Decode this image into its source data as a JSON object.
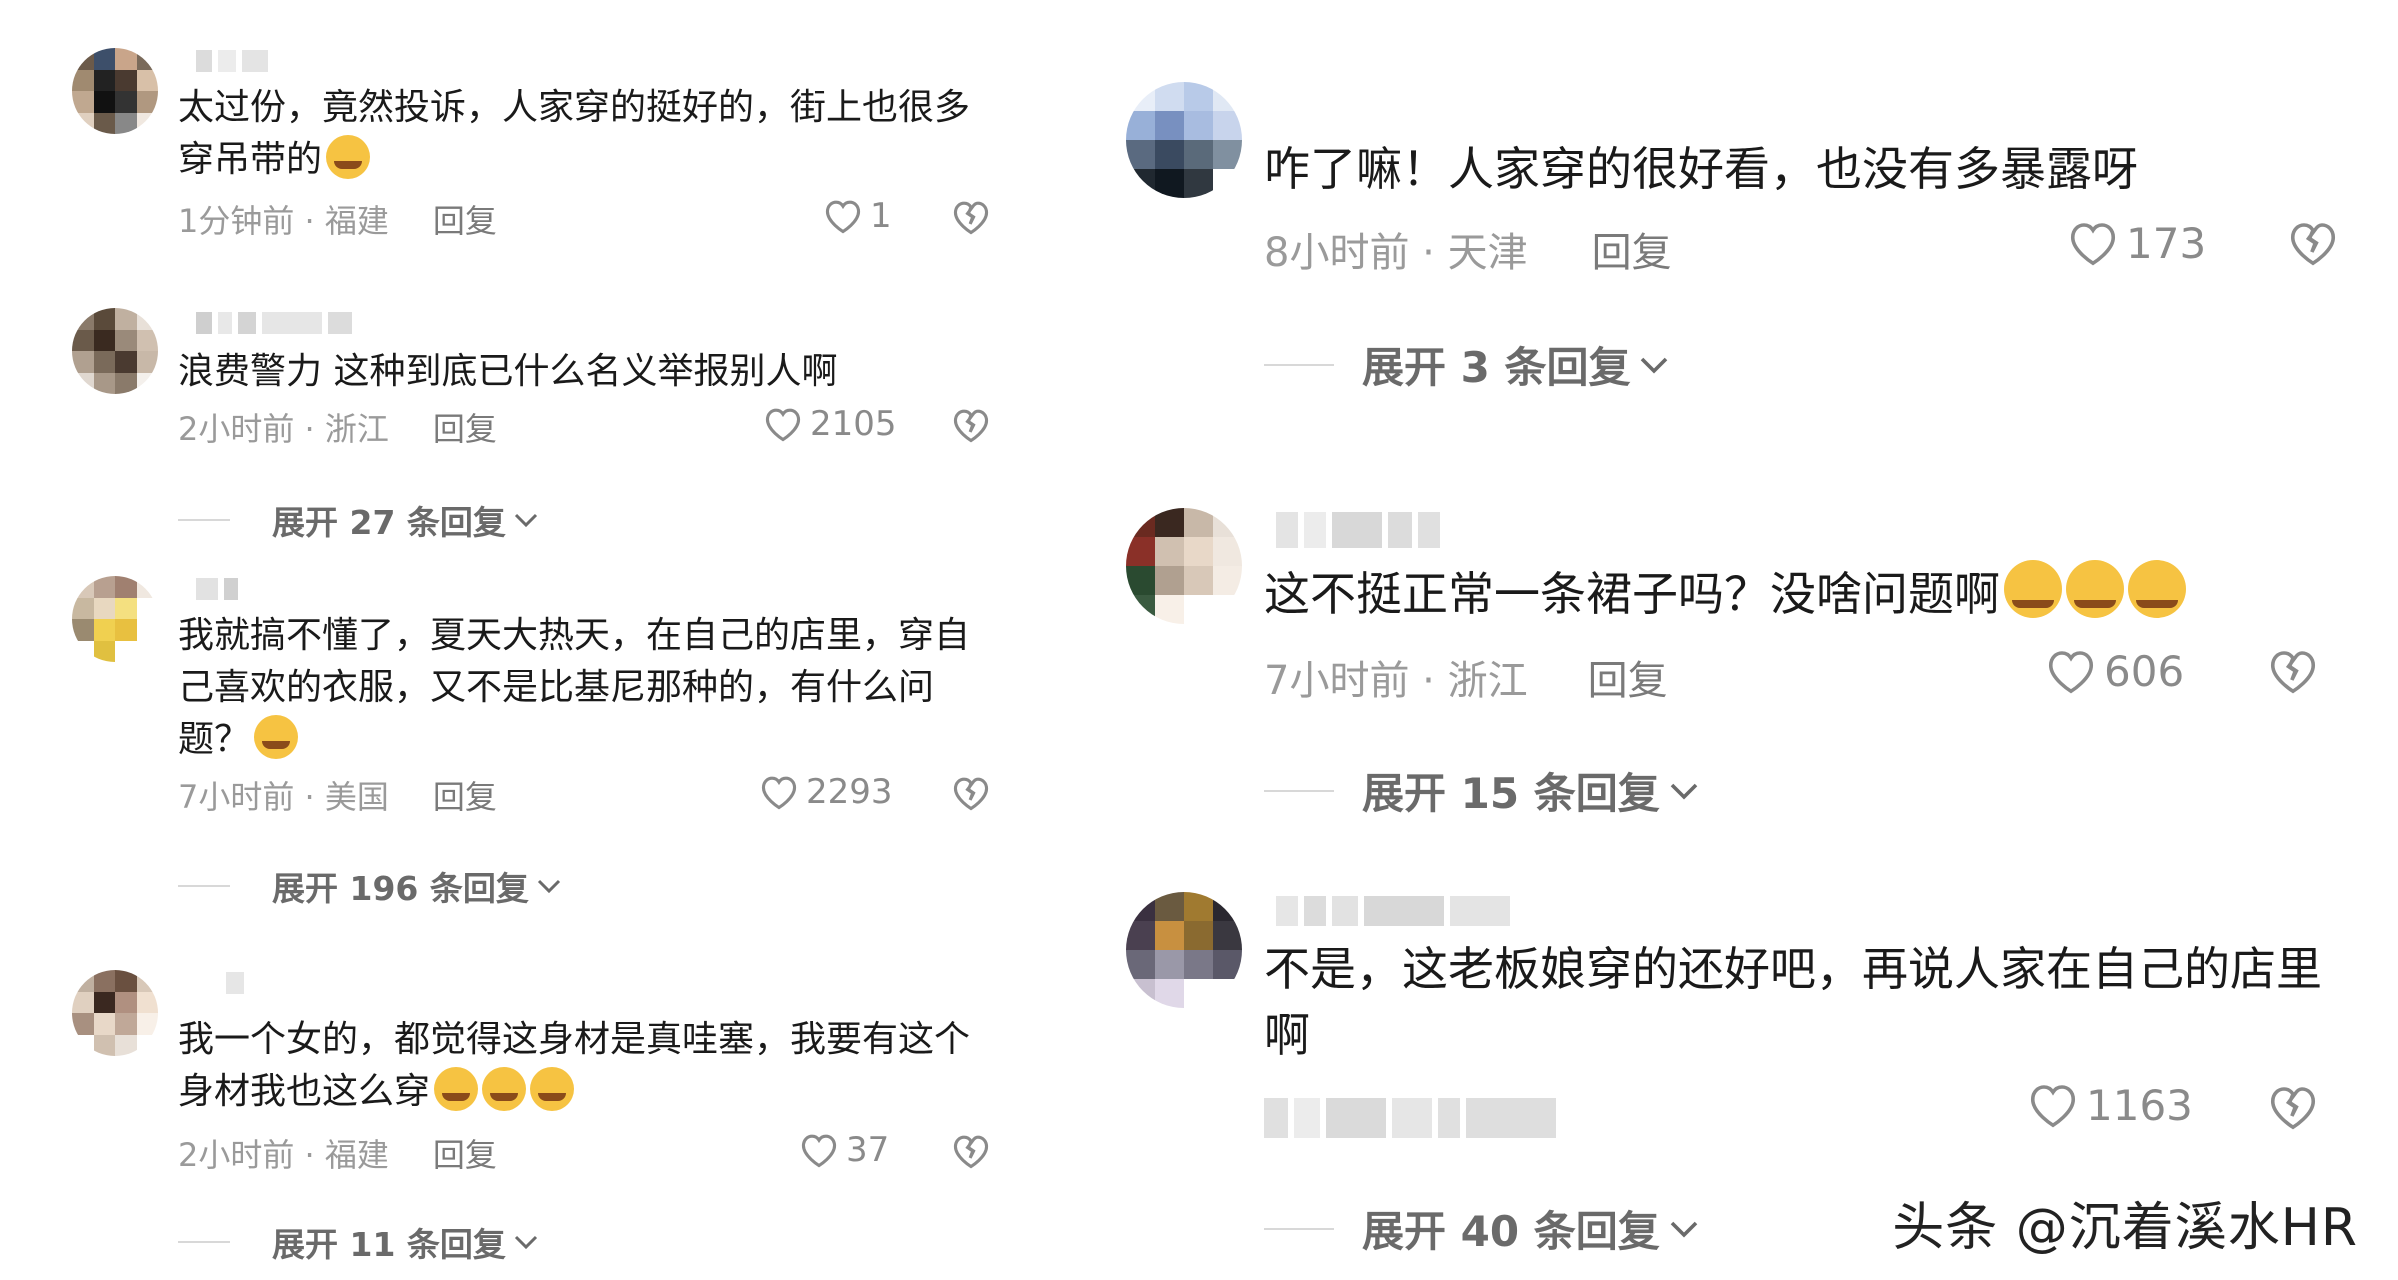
{
  "left_comments": [
    {
      "text": "太过份，竟然投诉，人家穿的挺好的，街上也很多穿吊带的",
      "emojis": 1,
      "time": "1分钟前 · 福建",
      "reply": "回复",
      "likes": "1",
      "expand": ""
    },
    {
      "text": "浪费警力  这种到底已什么名义举报别人啊",
      "emojis": 0,
      "time": "2小时前 · 浙江",
      "reply": "回复",
      "likes": "2105",
      "expand": "展开 27 条回复"
    },
    {
      "text": "我就搞不懂了，夏天大热天，在自己的店里，穿自己喜欢的衣服，又不是比基尼那种的，有什么问题？",
      "emojis": 1,
      "time": "7小时前 · 美国",
      "reply": "回复",
      "likes": "2293",
      "expand": "展开 196 条回复"
    },
    {
      "text": "我一个女的，都觉得这身材是真哇塞，我要有这个身材我也这么穿",
      "emojis": 3,
      "time": "2小时前 · 福建",
      "reply": "回复",
      "likes": "37",
      "expand": "展开 11 条回复"
    }
  ],
  "right_comments": [
    {
      "text": "咋了嘛！人家穿的很好看，也没有多暴露呀",
      "emojis": 0,
      "time": "8小时前 · 天津",
      "reply": "回复",
      "likes": "173",
      "expand": "展开 3 条回复"
    },
    {
      "text": "这不挺正常一条裙子吗？没啥问题啊",
      "emojis": 3,
      "time": "7小时前 · 浙江",
      "reply": "回复",
      "likes": "606",
      "expand": "展开 15 条回复"
    },
    {
      "text": "不是，这老板娘穿的还好吧，再说人家在自己的店里啊",
      "emojis": 0,
      "time": "",
      "reply": "",
      "likes": "1163",
      "expand": "展开 40 条回复"
    }
  ],
  "watermark": "头条 @沉着溪水HR",
  "colors": {
    "text": "#1a1a1a",
    "meta": "#9a9a9a",
    "emoji": "#f6c342"
  },
  "icons": {
    "like": "heart-icon",
    "dislike": "broken-heart-icon",
    "expand": "chevron-down-icon"
  }
}
